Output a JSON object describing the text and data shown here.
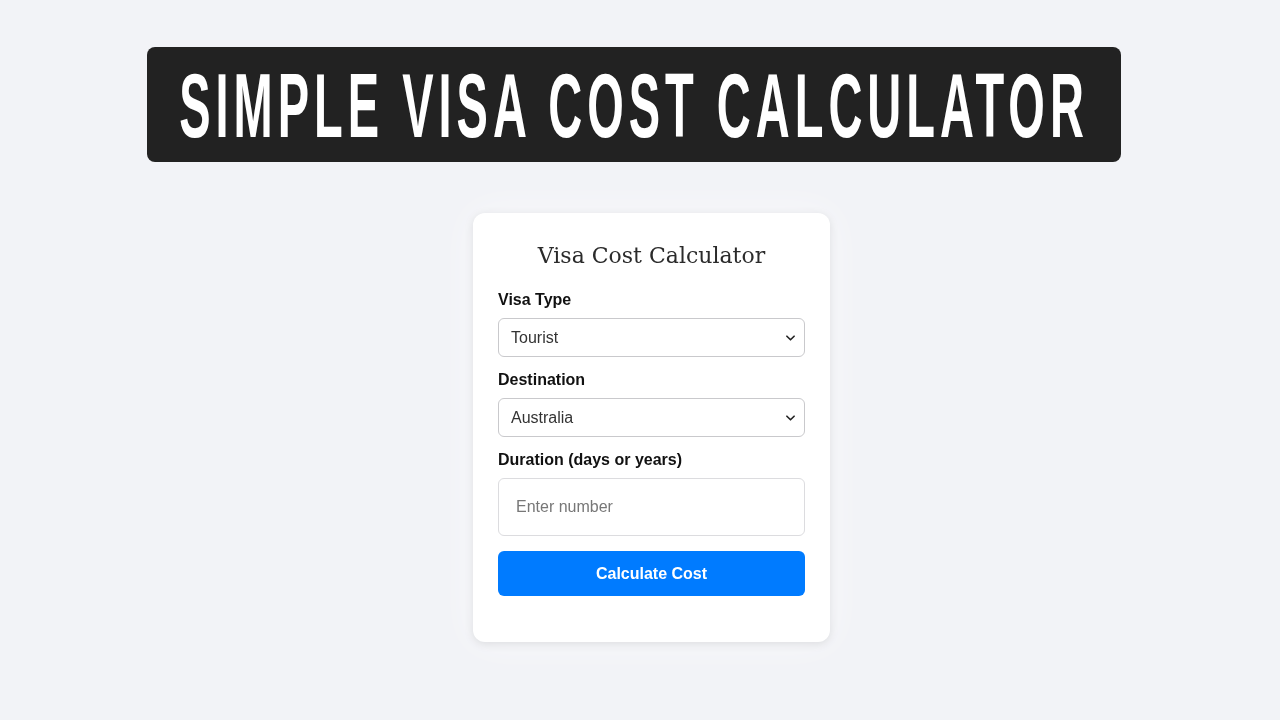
{
  "banner": {
    "title": "SIMPLE VISA COST CALCULATOR"
  },
  "card": {
    "title": "Visa Cost Calculator",
    "fields": [
      {
        "kind": "select",
        "label": "Visa Type",
        "value": "Tourist"
      },
      {
        "kind": "select",
        "label": "Destination",
        "value": "Australia"
      },
      {
        "kind": "number",
        "label": "Duration (days or years)",
        "placeholder": "Enter number"
      }
    ],
    "button": "Calculate Cost"
  }
}
